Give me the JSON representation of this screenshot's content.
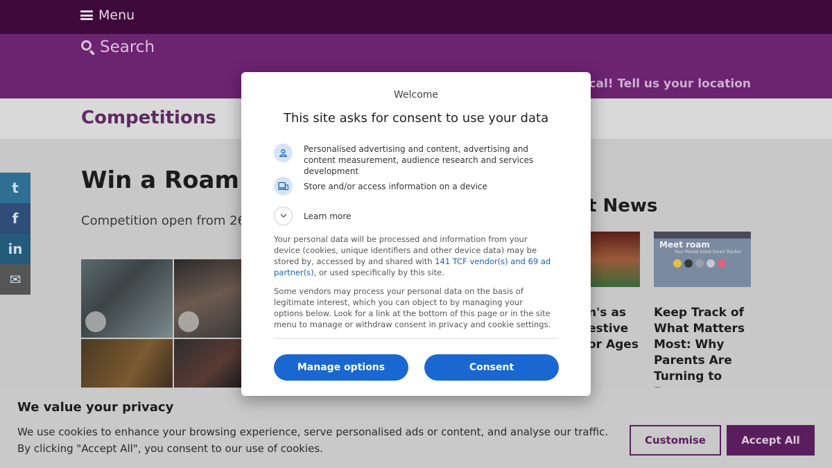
{
  "header": {
    "menu_label": "Menu",
    "search_label": "Search",
    "location_link": "ocal! Tell us your location"
  },
  "section": {
    "title": "Competitions"
  },
  "social": {
    "twitter": "t",
    "facebook": "f",
    "linkedin": "in",
    "email": "✉"
  },
  "article": {
    "title": "Win a Roam S",
    "subtitle": "Competition open from 26"
  },
  "latest": {
    "title": "t News",
    "thumb2_brand": "Meet roam",
    "thumb2_sub": "Your Pocket-Sized Smart Tracker",
    "news1_headline": "n's as estive or Ages",
    "news2_headline": "Keep Track of What Matters Most: Why Parents Are Turning to Roam"
  },
  "cookie_banner": {
    "title": "We value your privacy",
    "text": "We use cookies to enhance your browsing experience, serve personalised ads or content, and analyse our traffic. By clicking \"Accept All\", you consent to our use of cookies.",
    "customise_label": "Customise",
    "accept_label": "Accept All"
  },
  "modal": {
    "welcome": "Welcome",
    "title": "This site asks for consent to use your data",
    "purposes": [
      {
        "icon": "person-icon",
        "text": "Personalised advertising and content, advertising and content measurement, audience research and services development"
      },
      {
        "icon": "devices-icon",
        "text": "Store and/or access information on a device"
      }
    ],
    "learn_more": "Learn more",
    "para1_before": "Your personal data will be processed and information from your device (cookies, unique identifiers and other device data) may be stored by, accessed by and shared with ",
    "para1_link": "141 TCF vendor(s) and 69 ad partner(s)",
    "para1_after": ", or used specifically by this site.",
    "para2": "Some vendors may process your personal data on the basis of legitimate interest, which you can object to by managing your options below. Look for a link at the bottom of this page or in the site menu to manage or withdraw consent in privacy and cookie settings.",
    "manage_label": "Manage options",
    "consent_label": "Consent"
  },
  "colors": {
    "topbar": "#3d0a3a",
    "searchbar": "#6c2370",
    "brand_purple": "#5a1e5e",
    "consent_blue": "#1a67d2"
  }
}
